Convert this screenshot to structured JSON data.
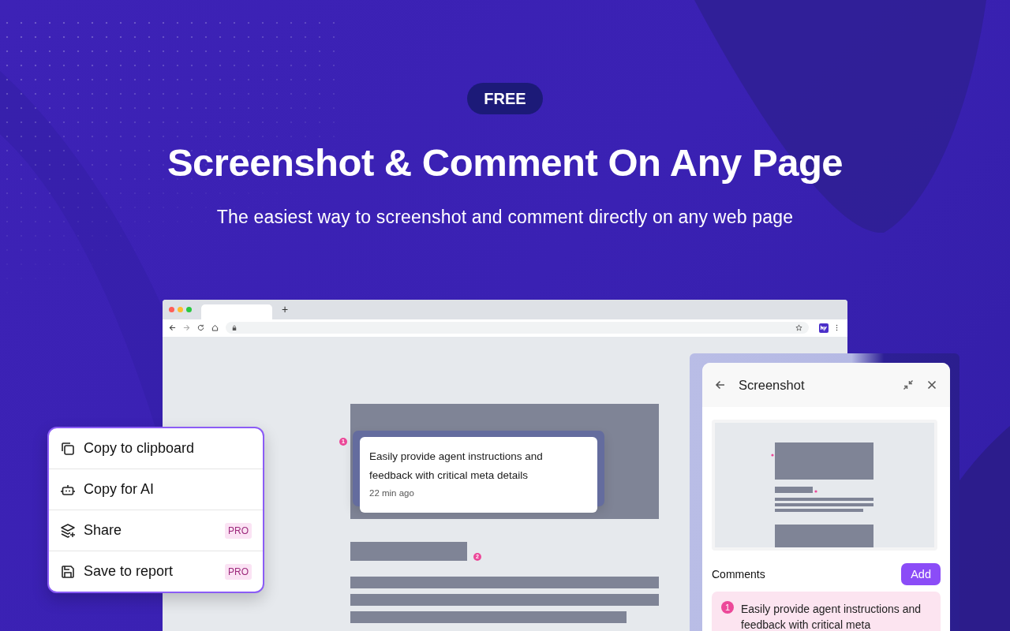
{
  "badge": "FREE",
  "title": "Screenshot & Comment On Any Page",
  "subtitle": "The easiest way to screenshot and comment directly on any web page",
  "browser": {
    "new_tab": "+"
  },
  "page": {
    "pins": [
      "1",
      "2"
    ],
    "comment": {
      "text": "Easily provide agent instructions and feedback with critical meta details",
      "time": "22 min ago"
    }
  },
  "menu": {
    "items": [
      {
        "label": "Copy to clipboard"
      },
      {
        "label": "Copy for AI"
      },
      {
        "label": "Share",
        "badge": "PRO"
      },
      {
        "label": "Save to report",
        "badge": "PRO"
      }
    ]
  },
  "panel": {
    "title": "Screenshot",
    "comments_label": "Comments",
    "add_button": "Add",
    "comments": [
      {
        "number": "1",
        "text": "Easily provide agent instructions and feedback with critical meta"
      }
    ]
  }
}
